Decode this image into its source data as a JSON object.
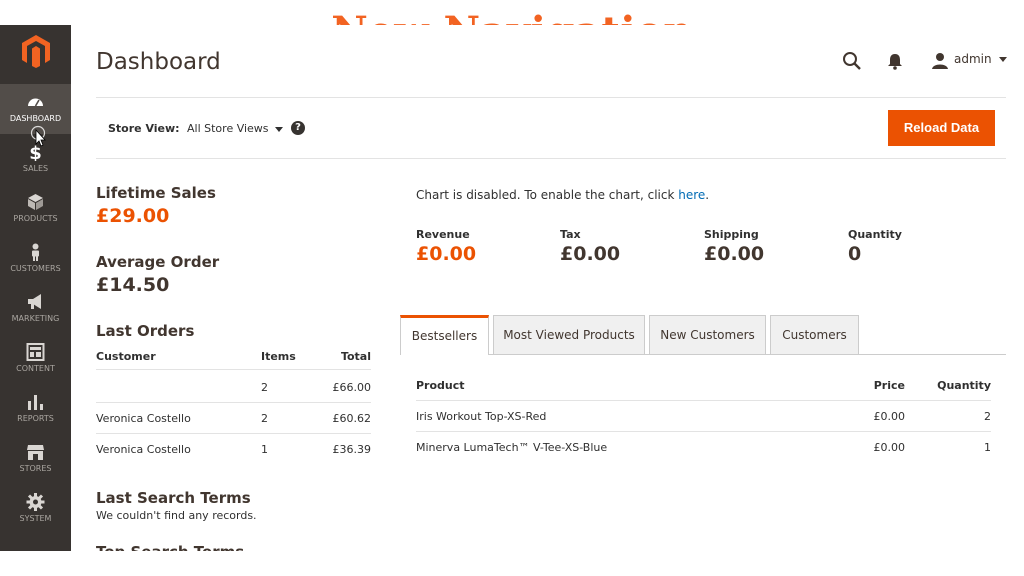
{
  "headline": "New Navigation",
  "sidebar": {
    "items": [
      {
        "label": "DASHBOARD",
        "icon": "dashboard-gauge-icon",
        "active": true
      },
      {
        "label": "SALES",
        "icon": "dollar-icon"
      },
      {
        "label": "PRODUCTS",
        "icon": "cube-icon"
      },
      {
        "label": "CUSTOMERS",
        "icon": "person-icon"
      },
      {
        "label": "MARKETING",
        "icon": "megaphone-icon"
      },
      {
        "label": "CONTENT",
        "icon": "layout-icon"
      },
      {
        "label": "REPORTS",
        "icon": "bar-chart-icon"
      },
      {
        "label": "STORES",
        "icon": "storefront-icon"
      },
      {
        "label": "SYSTEM",
        "icon": "gear-icon"
      }
    ]
  },
  "header": {
    "title": "Dashboard",
    "user": "admin"
  },
  "toolbar": {
    "store_view_label": "Store View:",
    "store_view_value": "All Store Views",
    "help": "?",
    "reload_label": "Reload Data"
  },
  "left": {
    "lifetime_sales_label": "Lifetime Sales",
    "lifetime_sales_value": "£29.00",
    "average_order_label": "Average Order",
    "average_order_value": "£14.50",
    "last_orders_title": "Last Orders",
    "last_orders_headers": [
      "Customer",
      "Items",
      "Total"
    ],
    "last_orders_rows": [
      {
        "customer": "",
        "items": "2",
        "total": "£66.00"
      },
      {
        "customer": "Veronica Costello",
        "items": "2",
        "total": "£60.62"
      },
      {
        "customer": "Veronica Costello",
        "items": "1",
        "total": "£36.39"
      }
    ],
    "last_search_title": "Last Search Terms",
    "last_search_empty": "We couldn't find any records.",
    "top_search_title": "Top Search Terms"
  },
  "right": {
    "chart_msg_prefix": "Chart is disabled. To enable the chart, click ",
    "chart_msg_link": "here",
    "chart_msg_suffix": ".",
    "stats": [
      {
        "label": "Revenue",
        "value": "£0.00"
      },
      {
        "label": "Tax",
        "value": "£0.00"
      },
      {
        "label": "Shipping",
        "value": "£0.00"
      },
      {
        "label": "Quantity",
        "value": "0"
      }
    ],
    "tabs": [
      "Bestsellers",
      "Most Viewed Products",
      "New Customers",
      "Customers"
    ],
    "table_headers": [
      "Product",
      "Price",
      "Quantity"
    ],
    "table_rows": [
      {
        "product": "Iris Workout Top-XS-Red",
        "price": "£0.00",
        "qty": "2"
      },
      {
        "product": "Minerva LumaTech™ V-Tee-XS-Blue",
        "price": "£0.00",
        "qty": "1"
      }
    ]
  },
  "colors": {
    "accent": "#eb5202",
    "sidebar_bg": "#373330",
    "sidebar_active": "#524d49",
    "link": "#006bb4"
  }
}
